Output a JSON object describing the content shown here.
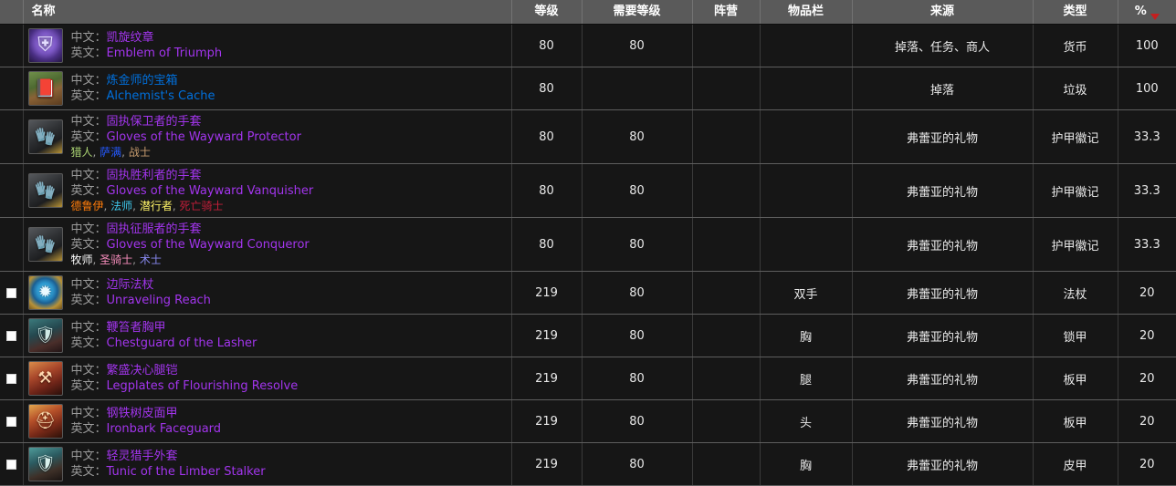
{
  "columns": [
    {
      "key": "check",
      "label": ""
    },
    {
      "key": "name",
      "label": "名称"
    },
    {
      "key": "level",
      "label": "等级"
    },
    {
      "key": "reqlvl",
      "label": "需要等级"
    },
    {
      "key": "side",
      "label": "阵营"
    },
    {
      "key": "slot",
      "label": "物品栏"
    },
    {
      "key": "source",
      "label": "来源"
    },
    {
      "key": "type",
      "label": "类型"
    },
    {
      "key": "pct",
      "label": "%"
    }
  ],
  "sort": {
    "column": "%",
    "direction": "desc",
    "indicator": "sort-desc-triangle-icon",
    "color": "#c41f1f"
  },
  "labels": {
    "zh": "中文：",
    "en": "英文："
  },
  "quality_colors": {
    "epic": "#a335ee",
    "rare": "#0070dd"
  },
  "class_colors": {
    "猎人": "#abd473",
    "萨满": "#2459ff",
    "战士": "#c69b6d",
    "德鲁伊": "#ff7c0a",
    "法师": "#3fc7eb",
    "潜行者": "#fff468",
    "死亡骑士": "#c41e3a",
    "牧师": "#ffffff",
    "圣骑士": "#f48cba",
    "术士": "#8788ee"
  },
  "rows": [
    {
      "checkbox": false,
      "icon": "emblem-of-triumph-icon",
      "icon_art": "art-emblem",
      "icon_glyph": "⛨",
      "zh": "凯旋纹章",
      "en": "Emblem of Triumph",
      "quality": "epic",
      "classes": [],
      "level": "80",
      "reqlvl": "80",
      "side": "",
      "slot": "",
      "source": "掉落、任务、商人",
      "type": "货币",
      "pct": "100"
    },
    {
      "checkbox": false,
      "icon": "alchemists-cache-icon",
      "icon_art": "art-book",
      "icon_glyph": "📕",
      "zh": "炼金师的宝箱",
      "en": "Alchemist's Cache",
      "quality": "rare",
      "classes": [],
      "level": "80",
      "reqlvl": "",
      "side": "",
      "slot": "",
      "source": "掉落",
      "type": "垃圾",
      "pct": "100"
    },
    {
      "checkbox": false,
      "icon": "gloves-wayward-protector-icon",
      "icon_art": "art-glove",
      "icon_glyph": "🧤",
      "zh": "固执保卫者的手套",
      "en": "Gloves of the Wayward Protector",
      "quality": "epic",
      "classes": [
        "猎人",
        "萨满",
        "战士"
      ],
      "level": "80",
      "reqlvl": "80",
      "side": "",
      "slot": "",
      "source": "弗蕾亚的礼物",
      "type": "护甲徽记",
      "pct": "33.3"
    },
    {
      "checkbox": false,
      "icon": "gloves-wayward-vanquisher-icon",
      "icon_art": "art-glove",
      "icon_glyph": "🧤",
      "zh": "固执胜利者的手套",
      "en": "Gloves of the Wayward Vanquisher",
      "quality": "epic",
      "classes": [
        "德鲁伊",
        "法师",
        "潜行者",
        "死亡骑士"
      ],
      "level": "80",
      "reqlvl": "80",
      "side": "",
      "slot": "",
      "source": "弗蕾亚的礼物",
      "type": "护甲徽记",
      "pct": "33.3"
    },
    {
      "checkbox": false,
      "icon": "gloves-wayward-conqueror-icon",
      "icon_art": "art-glove",
      "icon_glyph": "🧤",
      "zh": "固执征服者的手套",
      "en": "Gloves of the Wayward Conqueror",
      "quality": "epic",
      "classes": [
        "牧师",
        "圣骑士",
        "术士"
      ],
      "level": "80",
      "reqlvl": "80",
      "side": "",
      "slot": "",
      "source": "弗蕾亚的礼物",
      "type": "护甲徽记",
      "pct": "33.3"
    },
    {
      "checkbox": true,
      "icon": "unraveling-reach-icon",
      "icon_art": "art-staff",
      "icon_glyph": "✹",
      "zh": "边际法杖",
      "en": "Unraveling Reach",
      "quality": "epic",
      "classes": [],
      "level": "219",
      "reqlvl": "80",
      "side": "",
      "slot": "双手",
      "source": "弗蕾亚的礼物",
      "type": "法杖",
      "pct": "20"
    },
    {
      "checkbox": true,
      "icon": "chestguard-of-the-lasher-icon",
      "icon_art": "art-chest-teal",
      "icon_glyph": "🛡",
      "zh": "鞭笞者胸甲",
      "en": "Chestguard of the Lasher",
      "quality": "epic",
      "classes": [],
      "level": "219",
      "reqlvl": "80",
      "side": "",
      "slot": "胸",
      "source": "弗蕾亚的礼物",
      "type": "锁甲",
      "pct": "20"
    },
    {
      "checkbox": true,
      "icon": "legplates-of-flourishing-resolve-icon",
      "icon_art": "art-legs",
      "icon_glyph": "⚒",
      "zh": "繁盛决心腿铠",
      "en": "Legplates of Flourishing Resolve",
      "quality": "epic",
      "classes": [],
      "level": "219",
      "reqlvl": "80",
      "side": "",
      "slot": "腿",
      "source": "弗蕾亚的礼物",
      "type": "板甲",
      "pct": "20"
    },
    {
      "checkbox": true,
      "icon": "ironbark-faceguard-icon",
      "icon_art": "art-head",
      "icon_glyph": "⛑",
      "zh": "钢铁树皮面甲",
      "en": "Ironbark Faceguard",
      "quality": "epic",
      "classes": [],
      "level": "219",
      "reqlvl": "80",
      "side": "",
      "slot": "头",
      "source": "弗蕾亚的礼物",
      "type": "板甲",
      "pct": "20"
    },
    {
      "checkbox": true,
      "icon": "tunic-of-the-limber-stalker-icon",
      "icon_art": "art-tunic",
      "icon_glyph": "🛡",
      "zh": "轻灵猎手外套",
      "en": "Tunic of the Limber Stalker",
      "quality": "epic",
      "classes": [],
      "level": "219",
      "reqlvl": "80",
      "side": "",
      "slot": "胸",
      "source": "弗蕾亚的礼物",
      "type": "皮甲",
      "pct": "20"
    }
  ]
}
